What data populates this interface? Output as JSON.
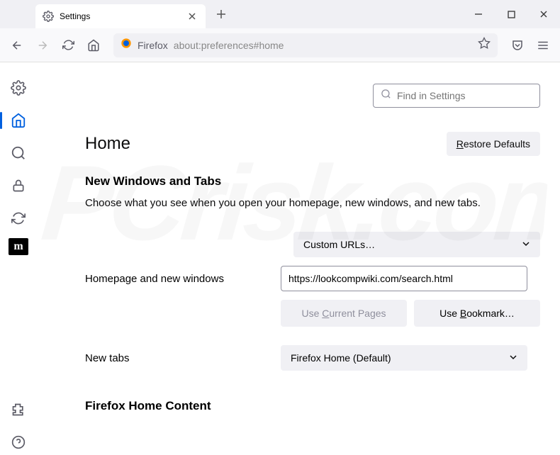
{
  "tab": {
    "label": "Settings"
  },
  "urlbar": {
    "brand": "Firefox",
    "url": "about:preferences#home"
  },
  "search": {
    "placeholder": "Find in Settings"
  },
  "page": {
    "title": "Home",
    "restore": "Restore Defaults",
    "section1_title": "New Windows and Tabs",
    "section1_desc": "Choose what you see when you open your homepage, new windows, and new tabs.",
    "homepage_select": "Custom URLs…",
    "homepage_label": "Homepage and new windows",
    "homepage_value": "https://lookcompwiki.com/search.html",
    "use_current": "Use Current Pages",
    "use_bookmark": "Use Bookmark…",
    "newtabs_label": "New tabs",
    "newtabs_select": "Firefox Home (Default)",
    "section2_title": "Firefox Home Content"
  },
  "sidebar_mozilla": "m"
}
